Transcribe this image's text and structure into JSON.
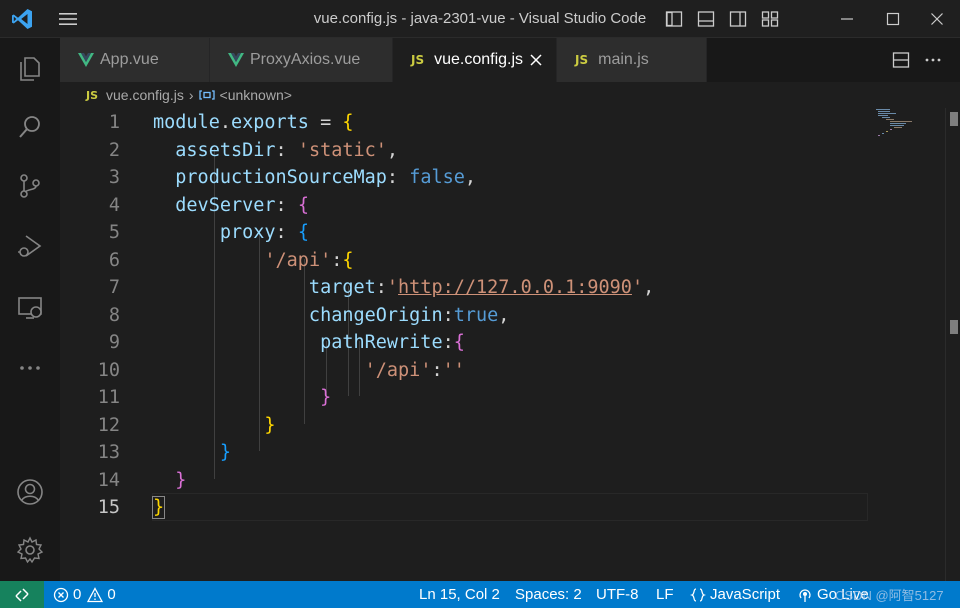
{
  "window": {
    "title": "vue.config.js - java-2301-vue - Visual Studio Code"
  },
  "tabs": [
    {
      "label": "App.vue",
      "icon": "vue-icon",
      "active": false
    },
    {
      "label": "ProxyAxios.vue",
      "icon": "vue-icon",
      "active": false
    },
    {
      "label": "vue.config.js",
      "icon": "js-icon",
      "icon_text": "JS",
      "active": true
    },
    {
      "label": "main.js",
      "icon": "js-icon",
      "icon_text": "JS",
      "active": false
    }
  ],
  "breadcrumb": {
    "icon_text": "JS",
    "file": "vue.config.js",
    "symbol": "<unknown>"
  },
  "editor": {
    "current_line": 15,
    "line_numbers": [
      "1",
      "2",
      "3",
      "4",
      "5",
      "6",
      "7",
      "8",
      "9",
      "10",
      "11",
      "12",
      "13",
      "14",
      "15"
    ],
    "lines": [
      [
        {
          "t": "module",
          "c": "k"
        },
        {
          "t": ".",
          "c": "o"
        },
        {
          "t": "exports",
          "c": "k"
        },
        {
          "t": " = ",
          "c": "o"
        },
        {
          "t": "{",
          "c": "br1"
        }
      ],
      [
        {
          "t": "  assetsDir",
          "c": "k"
        },
        {
          "t": ": ",
          "c": "o"
        },
        {
          "t": "'static'",
          "c": "s"
        },
        {
          "t": ",",
          "c": "o"
        }
      ],
      [
        {
          "t": "  productionSourceMap",
          "c": "k"
        },
        {
          "t": ": ",
          "c": "o"
        },
        {
          "t": "false",
          "c": "b"
        },
        {
          "t": ",",
          "c": "o"
        }
      ],
      [
        {
          "t": "  devServer",
          "c": "k"
        },
        {
          "t": ": ",
          "c": "o"
        },
        {
          "t": "{",
          "c": "br2"
        }
      ],
      [
        {
          "t": "      proxy",
          "c": "k"
        },
        {
          "t": ": ",
          "c": "o"
        },
        {
          "t": "{",
          "c": "br3"
        }
      ],
      [
        {
          "t": "          ",
          "c": "o"
        },
        {
          "t": "'/api'",
          "c": "s"
        },
        {
          "t": ":",
          "c": "o"
        },
        {
          "t": "{",
          "c": "br1"
        }
      ],
      [
        {
          "t": "              target",
          "c": "k"
        },
        {
          "t": ":",
          "c": "o"
        },
        {
          "t": "'",
          "c": "s"
        },
        {
          "t": "http://127.0.0.1:9090",
          "c": "s url"
        },
        {
          "t": "'",
          "c": "s"
        },
        {
          "t": ",",
          "c": "o"
        }
      ],
      [
        {
          "t": "              changeOrigin",
          "c": "k"
        },
        {
          "t": ":",
          "c": "o"
        },
        {
          "t": "true",
          "c": "b"
        },
        {
          "t": ",",
          "c": "o"
        }
      ],
      [
        {
          "t": "               pathRewrite",
          "c": "k"
        },
        {
          "t": ":",
          "c": "o"
        },
        {
          "t": "{",
          "c": "br2"
        }
      ],
      [
        {
          "t": "                   ",
          "c": "o"
        },
        {
          "t": "'/api'",
          "c": "s"
        },
        {
          "t": ":",
          "c": "o"
        },
        {
          "t": "''",
          "c": "s"
        }
      ],
      [
        {
          "t": "               ",
          "c": "o"
        },
        {
          "t": "}",
          "c": "br2"
        }
      ],
      [
        {
          "t": "          ",
          "c": "o"
        },
        {
          "t": "}",
          "c": "br1"
        }
      ],
      [
        {
          "t": "      ",
          "c": "o"
        },
        {
          "t": "}",
          "c": "br3"
        }
      ],
      [
        {
          "t": "  ",
          "c": "o"
        },
        {
          "t": "}",
          "c": "br2"
        }
      ],
      [
        {
          "t": "}",
          "c": "br1 bracket-match"
        }
      ]
    ]
  },
  "statusbar": {
    "errors": "0",
    "warnings": "0",
    "position": "Ln 15, Col 2",
    "spaces": "Spaces: 2",
    "encoding": "UTF-8",
    "eol": "LF",
    "language": "JavaScript",
    "golive": "Go Live"
  },
  "watermark": "CSDN @阿智5127",
  "colors": {
    "statusbar": "#007acc",
    "remote": "#16825d",
    "editor_bg": "#1e1e1e",
    "accent": "#0078d4"
  }
}
